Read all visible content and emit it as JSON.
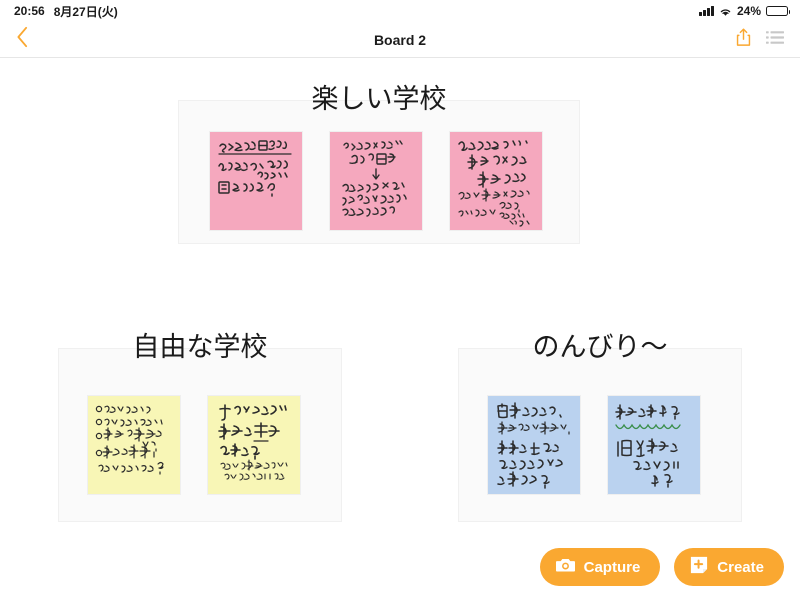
{
  "status_bar": {
    "time": "20:56",
    "date": "8月27日(火)",
    "battery_percent": "24%",
    "battery_level": 24,
    "signal_icon": "cellular-signal-icon",
    "wifi_icon": "wifi-icon",
    "battery_icon": "battery-icon"
  },
  "nav": {
    "back_icon": "chevron-left-icon",
    "title": "Board 2",
    "share_icon": "share-upload-icon",
    "menu_icon": "list-menu-icon",
    "accent_color": "#faa831",
    "menu_color": "#c8c8c8"
  },
  "colors": {
    "pink": "#f5a8be",
    "yellow": "#f8f6b6",
    "blue": "#bad2ef",
    "panel": "#fafafa",
    "ink": "#2b2b2b",
    "green_ink": "#3c8f4e"
  },
  "groups": [
    {
      "id": "group-1",
      "title": "楽しい学校",
      "note_color": "pink",
      "notes": [
        {
          "id": "note-1",
          "color": "pink",
          "lines": [
            "クラスが日がわり",
            "いろんな人と あそべる",
            "かかわれる。",
            "固定されない?"
          ],
          "has_underline": true
        },
        {
          "id": "note-2",
          "color": "pink",
          "lines": [
            "クリエイティブ",
            "休み時間",
            "↓",
            "自分たちで 考えて、",
            "あそんだり作ったりする",
            "やすみ時かん"
          ],
          "has_arrow": true
        },
        {
          "id": "note-3",
          "color": "pink",
          "lines": [
            "ひんぱんに",
            "学校外での",
            "学習がある",
            "机での学習以外も",
            "したい?",
            "たいけん的に",
            "いろんなこと",
            "スケッチ"
          ]
        }
      ]
    },
    {
      "id": "group-2",
      "title": "自由な学校",
      "note_color": "yellow",
      "notes": [
        {
          "id": "note-4",
          "color": "yellow",
          "lines": [
            "○ かみへもそめたい",
            "○ ゴムとかを自由にしたい",
            "○ 制服の選択が",
            "できる",
            "○ 自分の表現?",
            "おさえちゃいけない?"
          ],
          "has_bullets": true
        },
        {
          "id": "note-5",
          "color": "yellow",
          "lines": [
            "子どもたちが",
            "学校の主体",
            "になる?",
            "みんなで学校をつくっていく!",
            "自分たちでルールをつくる。"
          ],
          "has_underline": true
        }
      ]
    },
    {
      "id": "group-3",
      "title": "のんびり〜",
      "note_color": "blue",
      "notes": [
        {
          "id": "note-6",
          "color": "blue",
          "lines": [
            "宿題をなくなく、",
            "自分にあった勉強方法で",
            "先生と一緒に、",
            "どんなやり方ですす",
            "か考える。"
          ]
        },
        {
          "id": "note-7",
          "color": "blue",
          "lines": [
            "学校は週4日?",
            "個人的に",
            "のリクエスト",
            "する?"
          ],
          "has_wavy_underline": true
        }
      ]
    }
  ],
  "actions": [
    {
      "id": "capture",
      "label": "Capture",
      "icon": "camera-icon"
    },
    {
      "id": "create",
      "label": "Create",
      "icon": "add-card-icon"
    }
  ]
}
